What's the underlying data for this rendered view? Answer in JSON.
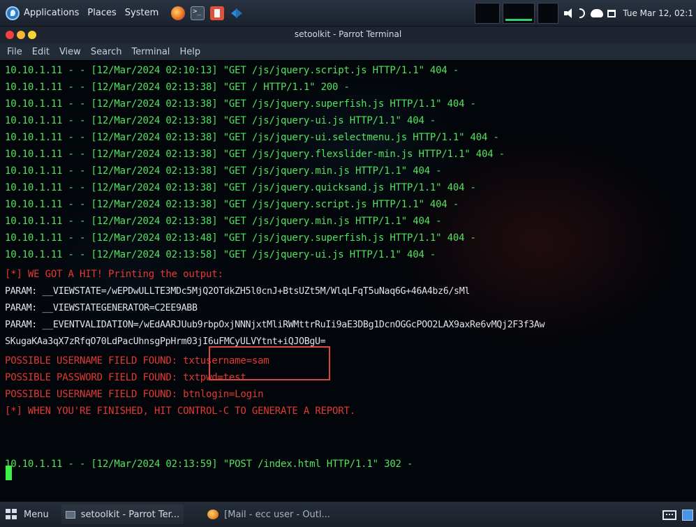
{
  "top_panel": {
    "menus": [
      "Applications",
      "Places",
      "System"
    ],
    "icons": [
      "parrot-logo-icon",
      "firefox-icon",
      "terminal-icon",
      "text-editor-icon",
      "vscode-icon"
    ],
    "clock": "Tue Mar 12, 02:1"
  },
  "window": {
    "title": "setoolkit - Parrot Terminal",
    "menu": [
      "File",
      "Edit",
      "View",
      "Search",
      "Terminal",
      "Help"
    ]
  },
  "terminal": {
    "log_lines": [
      "10.10.1.11 - - [12/Mar/2024 02:10:13] \"GET /js/jquery.script.js HTTP/1.1\" 404 -",
      "10.10.1.11 - - [12/Mar/2024 02:13:38] \"GET / HTTP/1.1\" 200 -",
      "10.10.1.11 - - [12/Mar/2024 02:13:38] \"GET /js/jquery.superfish.js HTTP/1.1\" 404 -",
      "10.10.1.11 - - [12/Mar/2024 02:13:38] \"GET /js/jquery-ui.js HTTP/1.1\" 404 -",
      "10.10.1.11 - - [12/Mar/2024 02:13:38] \"GET /js/jquery-ui.selectmenu.js HTTP/1.1\" 404 -",
      "10.10.1.11 - - [12/Mar/2024 02:13:38] \"GET /js/jquery.flexslider-min.js HTTP/1.1\" 404 -",
      "10.10.1.11 - - [12/Mar/2024 02:13:38] \"GET /js/jquery.min.js HTTP/1.1\" 404 -",
      "10.10.1.11 - - [12/Mar/2024 02:13:38] \"GET /js/jquery.quicksand.js HTTP/1.1\" 404 -",
      "10.10.1.11 - - [12/Mar/2024 02:13:38] \"GET /js/jquery.script.js HTTP/1.1\" 404 -",
      "10.10.1.11 - - [12/Mar/2024 02:13:38] \"GET /js/jquery.min.js HTTP/1.1\" 404 -",
      "10.10.1.11 - - [12/Mar/2024 02:13:48] \"GET /js/jquery.superfish.js HTTP/1.1\" 404 -",
      "10.10.1.11 - - [12/Mar/2024 02:13:58] \"GET /js/jquery-ui.js HTTP/1.1\" 404 -"
    ],
    "hit_line": "[*] WE GOT A HIT! Printing the output:",
    "param_lines": [
      "PARAM: __VIEWSTATE=/wEPDwULLTE3MDc5MjQ2OTdkZH5l0cnJ+BtsUZt5M/WlqLFqT5uNaq6G+46A4bz6/sMl",
      "PARAM: __VIEWSTATEGENERATOR=C2EE9ABB",
      "PARAM: __EVENTVALIDATION=/wEdAARJUub9rbpOxjNNNjxtMliRWMttrRuIi9aE3DBg1DcnOGGcPOO2LAX9axRe6vMQj2F3f3Aw",
      "SKugaKAa3qX7zRfqO70LdPacUhnsgPpHrm03jI6uFMCyULVYtnt+iQJOBgU="
    ],
    "found_fields": [
      {
        "label": "POSSIBLE USERNAME FIELD FOUND: ",
        "value": "txtusername=sam"
      },
      {
        "label": "POSSIBLE PASSWORD FIELD FOUND: ",
        "value": "txtpwd=test"
      },
      {
        "label": "POSSIBLE USERNAME FIELD FOUND: ",
        "value": "btnlogin=Login"
      }
    ],
    "finish_line": "[*] WHEN YOU'RE FINISHED, HIT CONTROL-C TO GENERATE A REPORT.",
    "post_line": "10.10.1.11 - - [12/Mar/2024 02:13:59] \"POST /index.html HTTP/1.1\" 302 -"
  },
  "taskbar": {
    "menu_label": "Menu",
    "tasks": [
      "setoolkit - Parrot Ter...",
      "[Mail - ecc user - Outl..."
    ]
  },
  "colors": {
    "log_green": "#52e35a",
    "alert_red": "#e4392f",
    "param_white": "#dfe4ea",
    "highlight_box": "#e0463e",
    "cursor": "#3cf04a"
  }
}
